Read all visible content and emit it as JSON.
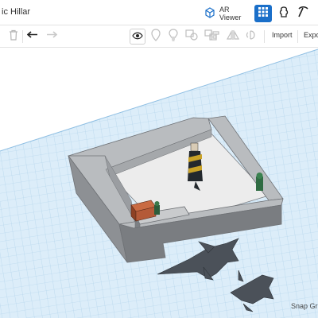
{
  "header": {
    "title": "ic Hillar",
    "ar_viewer_label": "AR Viewer"
  },
  "toolbar": {
    "import_label": "Import",
    "export_label": "Expo"
  },
  "workplane": {
    "snap_grid_label": "Snap Grid"
  },
  "icons": [
    "ar-cube-icon",
    "grid-view-icon",
    "brick-icon",
    "pickaxe-icon",
    "trash-icon",
    "undo-icon",
    "redo-icon",
    "show-all-icon",
    "note-icon",
    "bulb-icon",
    "group-icon",
    "ungroup-icon",
    "align-icon",
    "mirror-icon",
    "cut-icon"
  ],
  "colors": {
    "accent": "#1a6fc9",
    "grid": "#c3def1",
    "walls": "#8d9094",
    "chest": "#b45a38"
  }
}
